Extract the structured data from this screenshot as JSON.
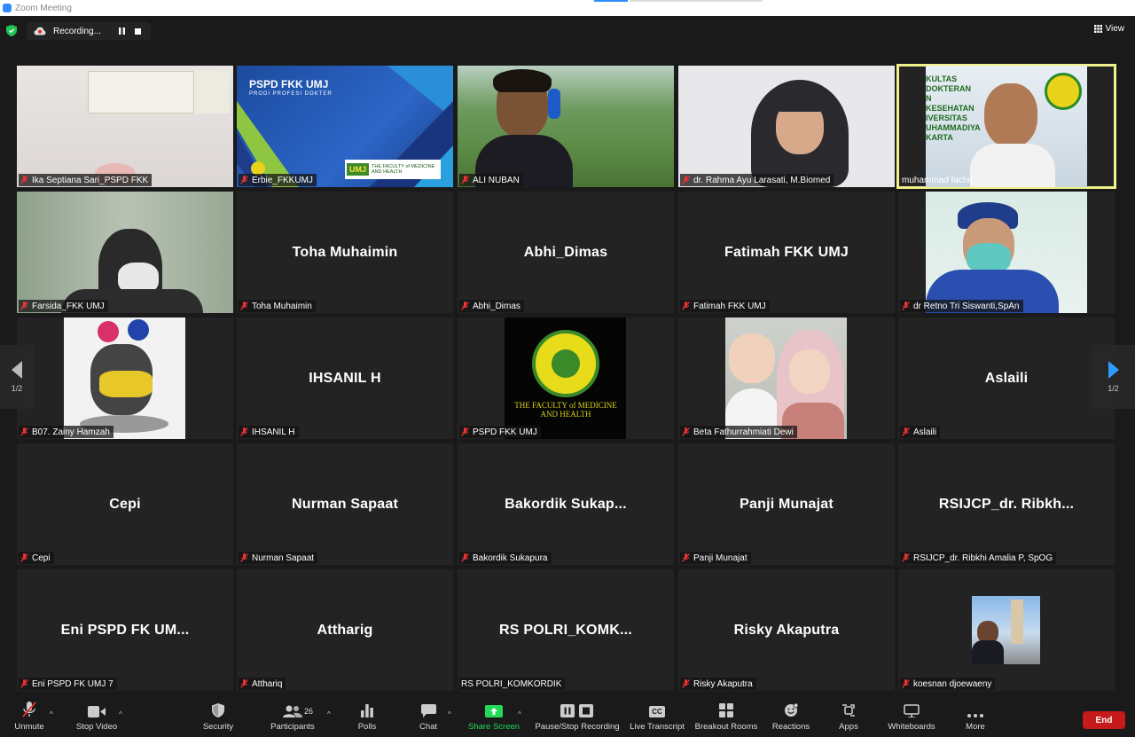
{
  "window": {
    "title": "Zoom Meeting"
  },
  "recording": {
    "label": "Recording..."
  },
  "view_label": "View",
  "pager": {
    "left": "1/2",
    "right": "1/2"
  },
  "participants": [
    {
      "name": "Ika Septiana Sari_PSPD FKK",
      "display": ""
    },
    {
      "name": "Erbie_FKKUMJ",
      "display": "",
      "banner_title": "PSPD FKK UMJ",
      "banner_sub": "PRODI PROFESI DOKTER",
      "logo_text": "UMJ",
      "faculty_text": "THE FACULTY of MEDICINE AND HEALTH"
    },
    {
      "name": "ALI NUBAN",
      "display": ""
    },
    {
      "name": "dr. Rahma Ayu Larasati, M.Biomed",
      "display": ""
    },
    {
      "name": "muhammad fachri",
      "display": "",
      "sign_text": "KULTAS DOKTERAN N KESEHATAN IVERSITAS UHAMMADIYA KARTA"
    },
    {
      "name": "Farsida_FKK UMJ",
      "display": ""
    },
    {
      "name": "Toha Muhaimin",
      "display": "Toha Muhaimin"
    },
    {
      "name": "Abhi_Dimas",
      "display": "Abhi_Dimas"
    },
    {
      "name": "Fatimah FKK UMJ",
      "display": "Fatimah FKK UMJ"
    },
    {
      "name": "dr Retno Tri Siswanti,SpAn",
      "display": ""
    },
    {
      "name": "B07.  Zainy Hamzah",
      "display": ""
    },
    {
      "name": "IHSANIL H",
      "display": "IHSANIL H"
    },
    {
      "name": "PSPD FKK UMJ",
      "display": "",
      "faculty_text": "THE FACULTY of MEDICINE AND HEALTH"
    },
    {
      "name": "Beta Fathurrahmiati Dewi",
      "display": ""
    },
    {
      "name": "Aslaili",
      "display": "Aslaili"
    },
    {
      "name": "Cepi",
      "display": "Cepi"
    },
    {
      "name": "Nurman Sapaat",
      "display": "Nurman Sapaat"
    },
    {
      "name": "Bakordik Sukapura",
      "display": "Bakordik  Sukap..."
    },
    {
      "name": "Panji Munajat",
      "display": "Panji Munajat"
    },
    {
      "name": "RSIJCP_dr. Ribkhi Amalia P, SpOG",
      "display": "RSIJCP_dr.  Ribkh..."
    },
    {
      "name": "Eni PSPD FK UMJ 7",
      "display": "Eni PSPD FK UM..."
    },
    {
      "name": "Atthariq",
      "display": "Attharig"
    },
    {
      "name": "RS POLRI_KOMKORDIK",
      "display": "RS  POLRI_KOMK..."
    },
    {
      "name": "Risky Akaputra",
      "display": "Risky Akaputra"
    },
    {
      "name": "koesnan djoewaeny",
      "display": ""
    }
  ],
  "toolbar": {
    "unmute": "Unmute",
    "stop_video": "Stop Video",
    "security": "Security",
    "participants": "Participants",
    "participants_count": "26",
    "polls": "Polls",
    "chat": "Chat",
    "share_screen": "Share Screen",
    "pause_recording": "Pause/Stop Recording",
    "live_transcript": "Live Transcript",
    "live_transcript_icon_text": "CC",
    "breakout_rooms": "Breakout Rooms",
    "reactions": "Reactions",
    "apps": "Apps",
    "whiteboards": "Whiteboards",
    "more": "More",
    "end": "End"
  },
  "colors": {
    "active_speaker": "#f0f08a",
    "end_button": "#c71a1a",
    "share_green": "#23d959",
    "accent": "#2d8cff"
  }
}
